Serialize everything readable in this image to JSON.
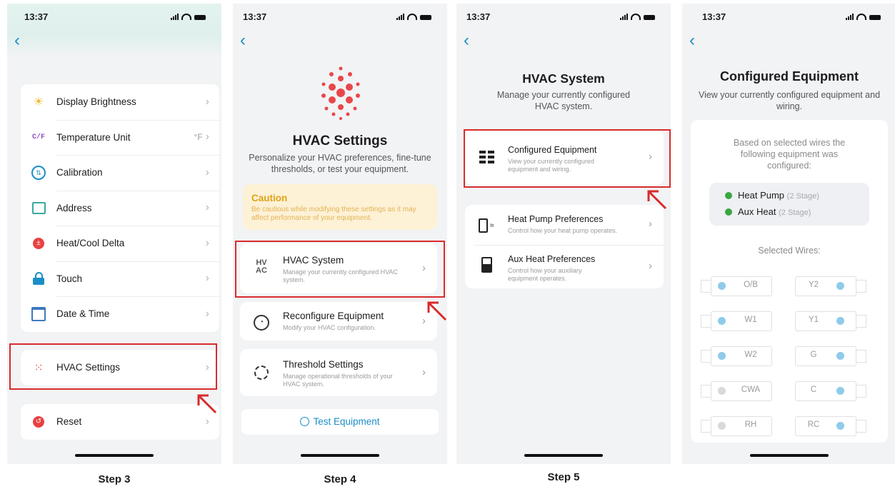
{
  "status": {
    "time": "13:37"
  },
  "colors": {
    "accent": "#1b8ec7",
    "highlight": "#d82b2b",
    "caution_title": "#e0a318",
    "wire_active": "#8ecbeb",
    "wire_inactive": "#d9d9d9",
    "check": "#3aa640"
  },
  "steps": [
    "Step 3",
    "Step 4",
    "Step 5"
  ],
  "screen1": {
    "menu": [
      {
        "label": "Display Brightness",
        "icon": "sun-icon",
        "value": ""
      },
      {
        "label": "Temperature Unit",
        "icon": "cf-icon",
        "value": "°F"
      },
      {
        "label": "Calibration",
        "icon": "calibration-icon",
        "value": ""
      },
      {
        "label": "Address",
        "icon": "address-icon",
        "value": ""
      },
      {
        "label": "Heat/Cool Delta",
        "icon": "delta-icon",
        "value": ""
      },
      {
        "label": "Touch",
        "icon": "lock-icon",
        "value": ""
      },
      {
        "label": "Date & Time",
        "icon": "calendar-icon",
        "value": ""
      }
    ],
    "hvac": "HVAC Settings",
    "reset": "Reset",
    "cf_glyph": "C/F"
  },
  "screen2": {
    "title": "HVAC Settings",
    "subtitle": "Personalize your HVAC preferences, fine-tune thresholds, or test your equipment.",
    "caution_title": "Caution",
    "caution_text": "Be cautious while modifying these settings as it may affect performance of your equipment.",
    "items": [
      {
        "title": "HVAC System",
        "desc": "Manage your currently configured HVAC system.",
        "icon_text": "HV AC"
      },
      {
        "title": "Reconfigure Equipment",
        "desc": "Modify your HVAC configuration."
      },
      {
        "title": "Threshold Settings",
        "desc": "Manage operational thresholds of your HVAC system."
      }
    ],
    "test_button": "Test Equipment"
  },
  "screen3": {
    "title": "HVAC System",
    "subtitle": "Manage your currently configured HVAC system.",
    "items": [
      {
        "title": "Configured Equipment",
        "desc": "View your currently configured equipment and wiring."
      },
      {
        "title": "Heat Pump Preferences",
        "desc": "Control how your heat pump operates."
      },
      {
        "title": "Aux Heat Preferences",
        "desc": "Control how your auxiliary equipment operates."
      }
    ]
  },
  "screen4": {
    "title": "Configured Equipment",
    "subtitle": "View your currently configured equipment and wiring.",
    "based_text": "Based on selected wires the following equipment was configured:",
    "equipment": [
      {
        "name": "Heat Pump",
        "stage": "(2 Stage)"
      },
      {
        "name": "Aux Heat",
        "stage": "(2 Stage)"
      }
    ],
    "wires_label": "Selected Wires:",
    "wires_left": [
      {
        "label": "O/B",
        "active": true
      },
      {
        "label": "W1",
        "active": true
      },
      {
        "label": "W2",
        "active": true
      },
      {
        "label": "CWA",
        "active": false
      },
      {
        "label": "RH",
        "active": false
      }
    ],
    "wires_right": [
      {
        "label": "Y2",
        "active": true
      },
      {
        "label": "Y1",
        "active": true
      },
      {
        "label": "G",
        "active": true
      },
      {
        "label": "C",
        "active": true
      },
      {
        "label": "RC",
        "active": true
      }
    ]
  }
}
